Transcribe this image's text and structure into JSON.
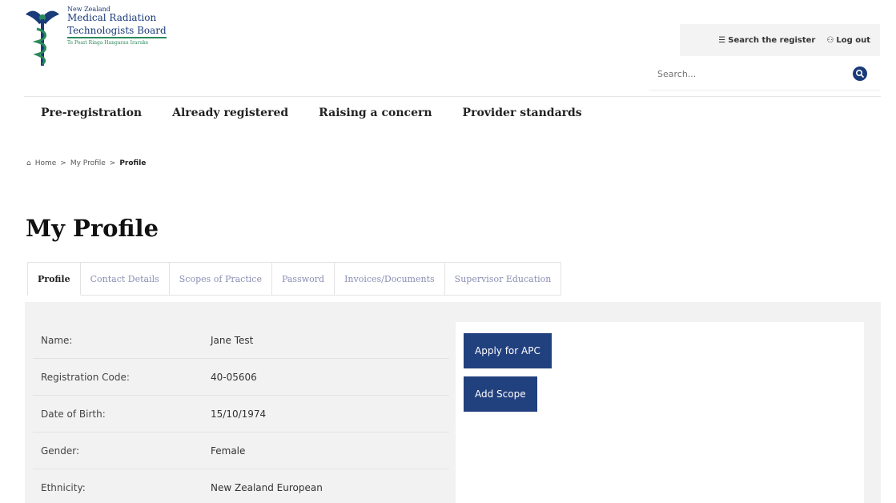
{
  "brand": {
    "line1": "New Zealand",
    "line2": "Medical Radiation",
    "line3": "Technologists Board",
    "tagline": "Te Poari Ringa Hangarau Iraruke"
  },
  "header": {
    "search_register_label": "Search the register",
    "logout_label": "Log out",
    "search_placeholder": "Search..."
  },
  "main_nav": [
    "Pre-registration",
    "Already registered",
    "Raising a concern",
    "Provider standards"
  ],
  "breadcrumb": {
    "home": "Home",
    "sep": ">",
    "parent": "My Profile",
    "current": "Profile"
  },
  "page_title": "My Profile",
  "tabs": [
    "Profile",
    "Contact Details",
    "Scopes of Practice",
    "Password",
    "Invoices/Documents",
    "Supervisor Education"
  ],
  "profile": [
    {
      "label": "Name:",
      "value": "Jane Test"
    },
    {
      "label": "Registration Code:",
      "value": "40-05606"
    },
    {
      "label": "Date of Birth:",
      "value": "15/10/1974"
    },
    {
      "label": "Gender:",
      "value": "Female"
    },
    {
      "label": "Ethnicity:",
      "value": "New Zealand European"
    }
  ],
  "actions": {
    "apply_apc": "Apply for APC",
    "add_scope": "Add Scope"
  },
  "colors": {
    "brand_navy": "#21407e",
    "accent_green": "#2a8a5a"
  }
}
